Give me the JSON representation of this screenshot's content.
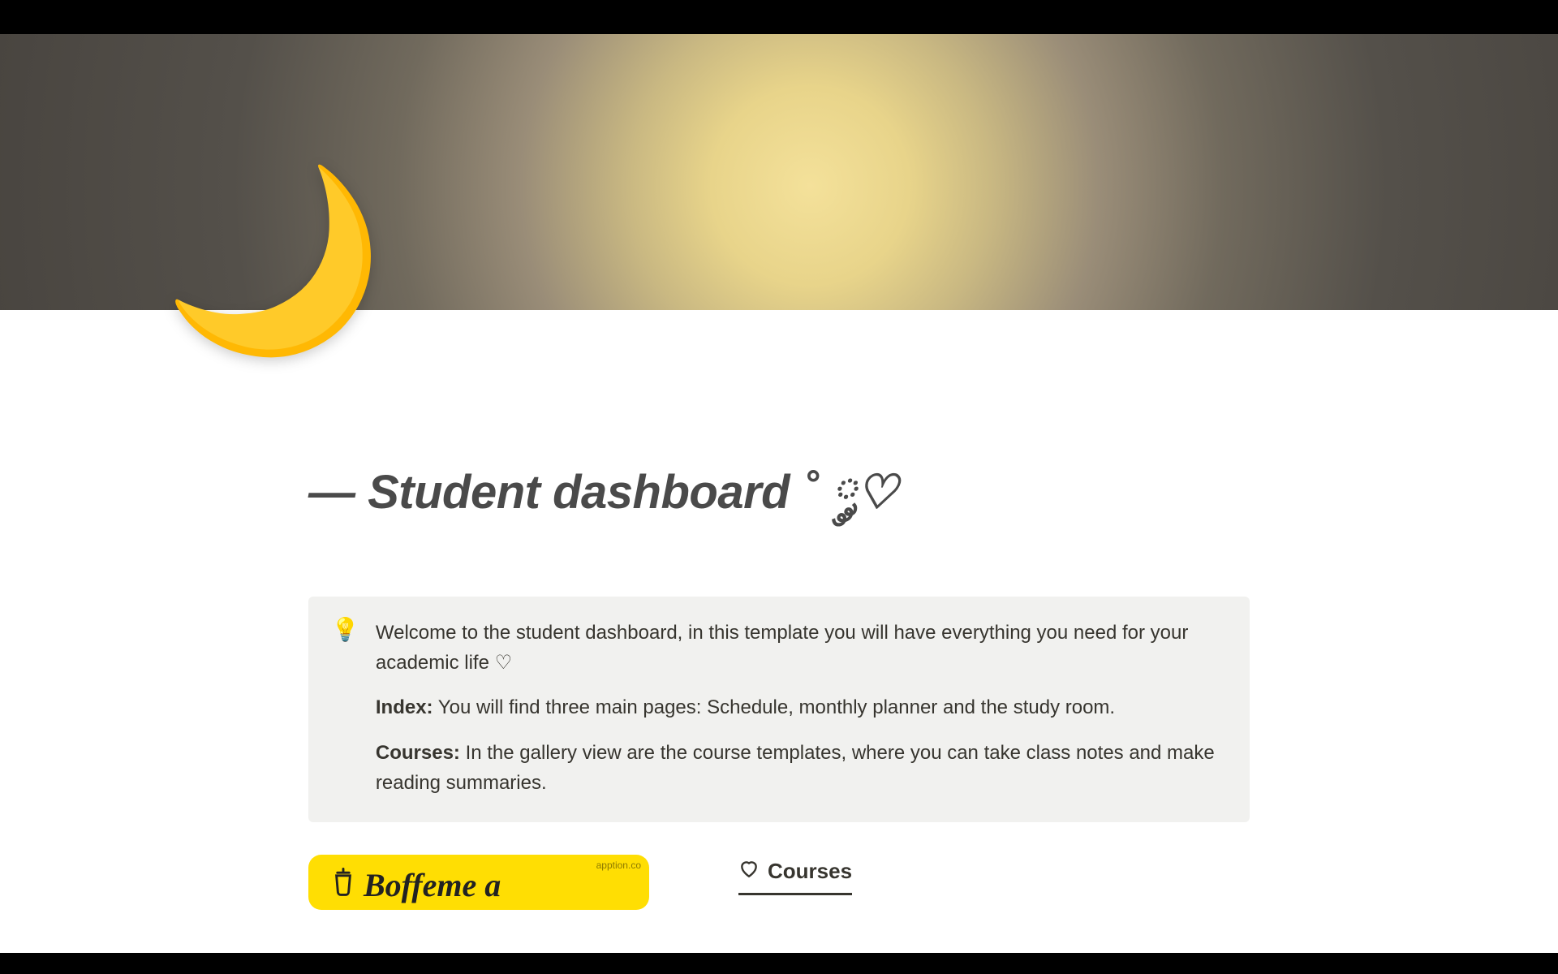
{
  "page": {
    "title": "— Student dashboard ˚ ༘♡",
    "icon_emoji": "🌙"
  },
  "callout": {
    "icon": "💡",
    "welcome": "Welcome to the student dashboard, in this template you will have everything you need for your academic life ♡",
    "index_label": "Index:",
    "index_text": " You will find three main pages: Schedule, monthly planner and the study room.",
    "courses_label": "Courses:",
    "courses_text": " In the gallery view are the course templates, where you can take class notes and make reading summaries."
  },
  "bmac": {
    "label": "Boffeme a",
    "badge": "apption.co"
  },
  "tabs": {
    "courses": "Courses"
  }
}
